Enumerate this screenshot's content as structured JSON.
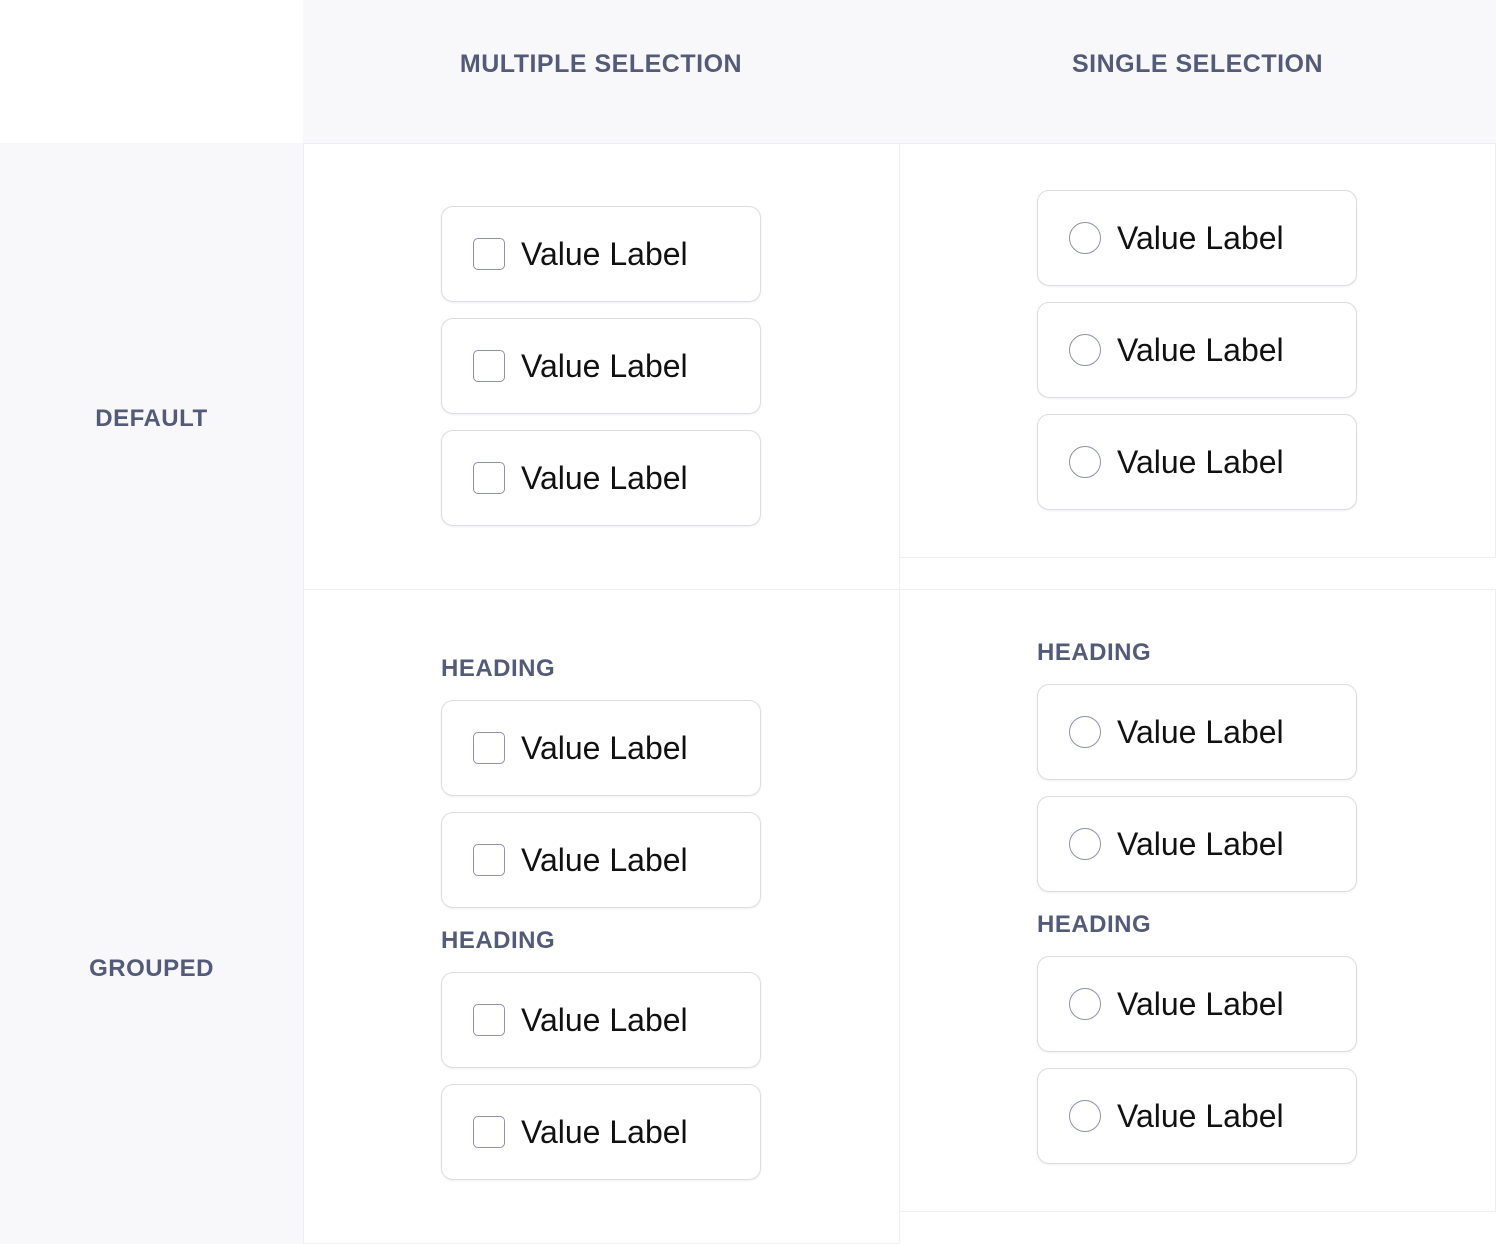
{
  "columns": {
    "multiple": "MULTIPLE SELECTION",
    "single": "SINGLE SELECTION"
  },
  "rows": {
    "default": "DEFAULT",
    "grouped": "GROUPED"
  },
  "default_multiple": {
    "options": [
      "Value Label",
      "Value Label",
      "Value Label"
    ]
  },
  "default_single": {
    "options": [
      "Value Label",
      "Value Label",
      "Value Label"
    ]
  },
  "grouped_multiple": {
    "groups": [
      {
        "heading": "HEADING",
        "options": [
          "Value Label",
          "Value Label"
        ]
      },
      {
        "heading": "HEADING",
        "options": [
          "Value Label",
          "Value Label"
        ]
      }
    ]
  },
  "grouped_single": {
    "groups": [
      {
        "heading": "HEADING",
        "options": [
          "Value Label",
          "Value Label"
        ]
      },
      {
        "heading": "HEADING",
        "options": [
          "Value Label",
          "Value Label"
        ]
      }
    ]
  }
}
